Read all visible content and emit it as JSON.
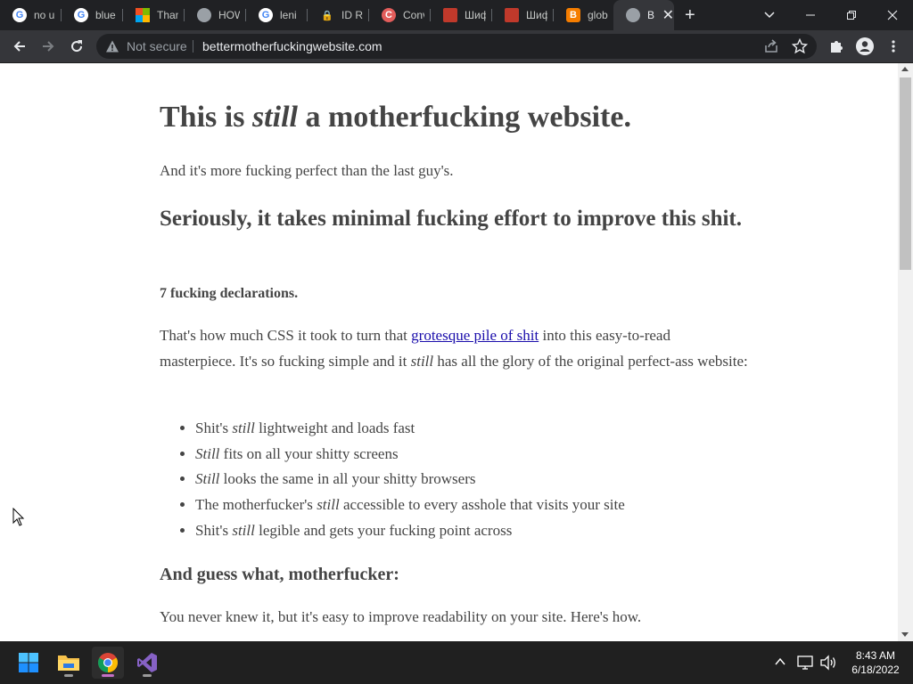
{
  "browser": {
    "tabs": [
      {
        "icon": "google-icon",
        "title": "no u"
      },
      {
        "icon": "google-icon",
        "title": "blue"
      },
      {
        "icon": "microsoft-icon",
        "title": "Than"
      },
      {
        "icon": "globe-icon",
        "title": "HOW"
      },
      {
        "icon": "google-icon",
        "title": "leni"
      },
      {
        "icon": "lock-icon",
        "title": "ID Re"
      },
      {
        "icon": "converter-icon",
        "title": "Conv"
      },
      {
        "icon": "cyrillic-site-icon",
        "title": "Шиф"
      },
      {
        "icon": "cyrillic-site-icon",
        "title": "Шиф"
      },
      {
        "icon": "blogger-icon",
        "title": "glob"
      },
      {
        "icon": "globe-icon",
        "title": "B",
        "active": true
      }
    ],
    "security_label": "Not secure",
    "url": "bettermotherfuckingwebsite.com"
  },
  "page": {
    "heading": {
      "before": "This is ",
      "em": "still",
      "after": " a motherfucking website."
    },
    "intro": "And it's more fucking perfect than the last guy's.",
    "subheading": "Seriously, it takes minimal fucking effort to improve this shit.",
    "declarations": "7 fucking declarations.",
    "para": {
      "before_link": "That's how much CSS it took to turn that ",
      "link": "grotesque pile of shit",
      "after_link": " into this easy-to-read masterpiece. It's so fucking simple and it ",
      "em": "still",
      "end": " has all the glory of the original perfect-ass website:"
    },
    "bullets": [
      {
        "before": "Shit's ",
        "em": "still",
        "after": " lightweight and loads fast"
      },
      {
        "before": "",
        "em": "Still",
        "after": " fits on all your shitty screens"
      },
      {
        "before": "",
        "em": "Still",
        "after": " looks the same in all your shitty browsers"
      },
      {
        "before": "The motherfucker's ",
        "em": "still",
        "after": " accessible to every asshole that visits your site"
      },
      {
        "before": "Shit's ",
        "em": "still",
        "after": " legible and gets your fucking point across"
      }
    ],
    "guess_heading": "And guess what, motherfucker:",
    "readability": "You never knew it, but it's easy to improve readability on your site. Here's how."
  },
  "taskbar": {
    "apps": [
      "windows-start-icon",
      "file-explorer-icon",
      "chrome-icon",
      "visual-studio-icon"
    ],
    "time": "8:43 AM",
    "date": "6/18/2022"
  }
}
